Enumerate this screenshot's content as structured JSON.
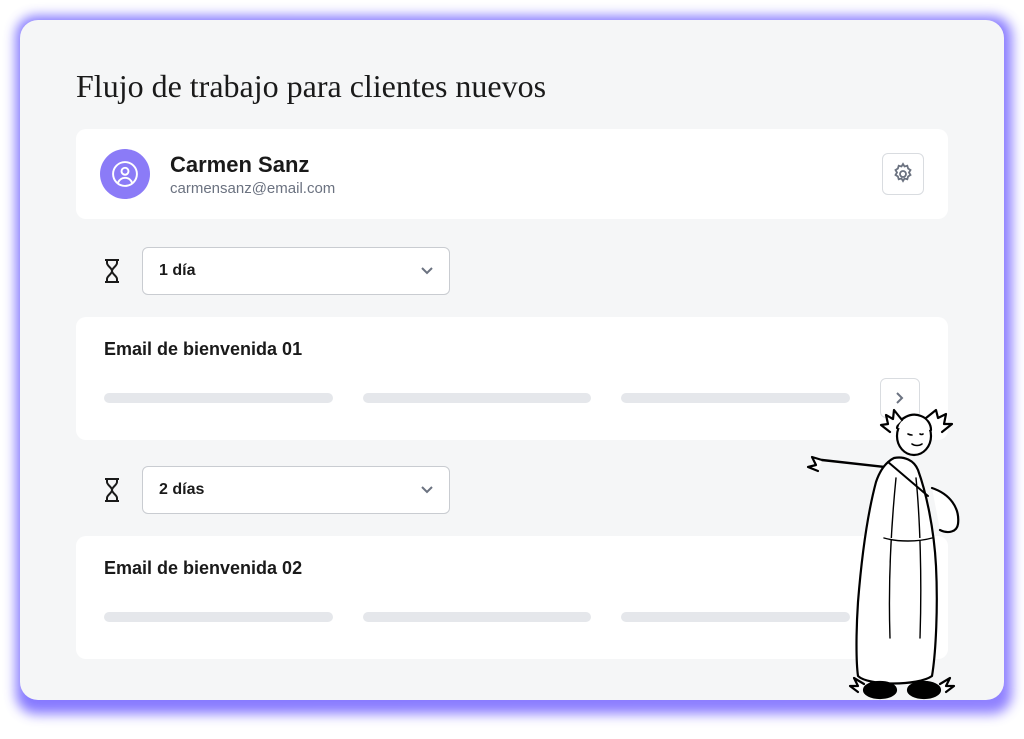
{
  "title": "Flujo de trabajo para clientes nuevos",
  "contact": {
    "name": "Carmen Sanz",
    "email": "carmensanz@email.com"
  },
  "steps": [
    {
      "delay_label": "1 día",
      "email_title": "Email de bienvenida 01"
    },
    {
      "delay_label": "2 días",
      "email_title": "Email de bienvenida 02"
    }
  ],
  "colors": {
    "accent": "#8b7bf7",
    "glow": "#6a5cff",
    "border": "#d9dce0",
    "placeholder": "#e5e7eb",
    "muted": "#6b7280"
  }
}
